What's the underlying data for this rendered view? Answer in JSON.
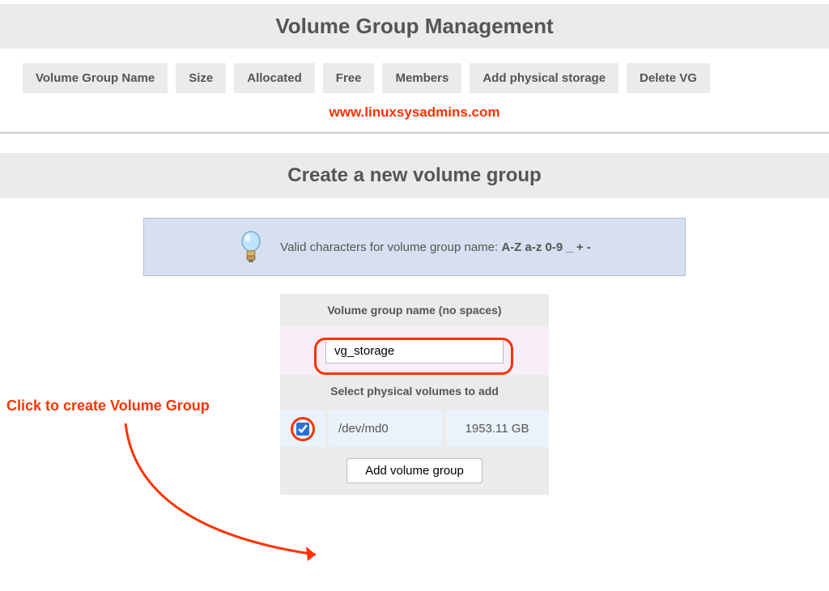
{
  "header": {
    "title": "Volume Group Management"
  },
  "columns": [
    "Volume Group Name",
    "Size",
    "Allocated",
    "Free",
    "Members",
    "Add physical storage",
    "Delete VG"
  ],
  "watermark": "www.linuxsysadmins.com",
  "create": {
    "title": "Create a new volume group",
    "hint_prefix": "Valid characters for volume group name: ",
    "hint_chars": "A-Z a-z 0-9 _ + -",
    "name_label": "Volume group name (no spaces)",
    "name_value": "vg_storage",
    "pv_label": "Select physical volumes to add",
    "pv_device": "/dev/md0",
    "pv_size": "1953.11 GB",
    "submit_label": "Add volume group"
  },
  "annotation": {
    "text": "Click to create Volume Group"
  }
}
